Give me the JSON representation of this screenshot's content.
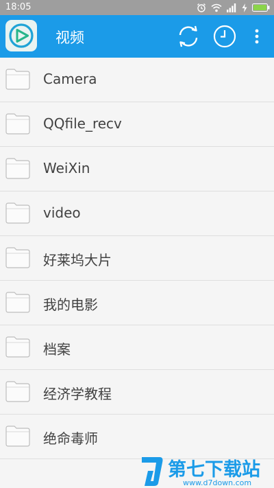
{
  "status_bar": {
    "time": "18:05",
    "icons": [
      "alarm-icon",
      "wifi-icon",
      "signal-icon",
      "charging-icon",
      "battery-icon"
    ]
  },
  "app_bar": {
    "title": "视频",
    "logo_icon": "play-logo-icon",
    "actions": [
      "sync-icon",
      "clock-icon",
      "more-vert-icon"
    ],
    "background_color": "#1b9be8"
  },
  "folders": [
    {
      "name": "Camera",
      "icon": "folder-icon"
    },
    {
      "name": "QQfile_recv",
      "icon": "folder-icon"
    },
    {
      "name": "WeiXin",
      "icon": "folder-icon"
    },
    {
      "name": "video",
      "icon": "folder-icon"
    },
    {
      "name": "好莱坞大片",
      "icon": "folder-icon"
    },
    {
      "name": "我的电影",
      "icon": "folder-icon"
    },
    {
      "name": "档案",
      "icon": "folder-icon"
    },
    {
      "name": "经济学教程",
      "icon": "folder-icon"
    },
    {
      "name": "绝命毒师",
      "icon": "folder-icon"
    }
  ],
  "watermark": {
    "brand": "第七下载站",
    "url": "www.d7down.com"
  }
}
